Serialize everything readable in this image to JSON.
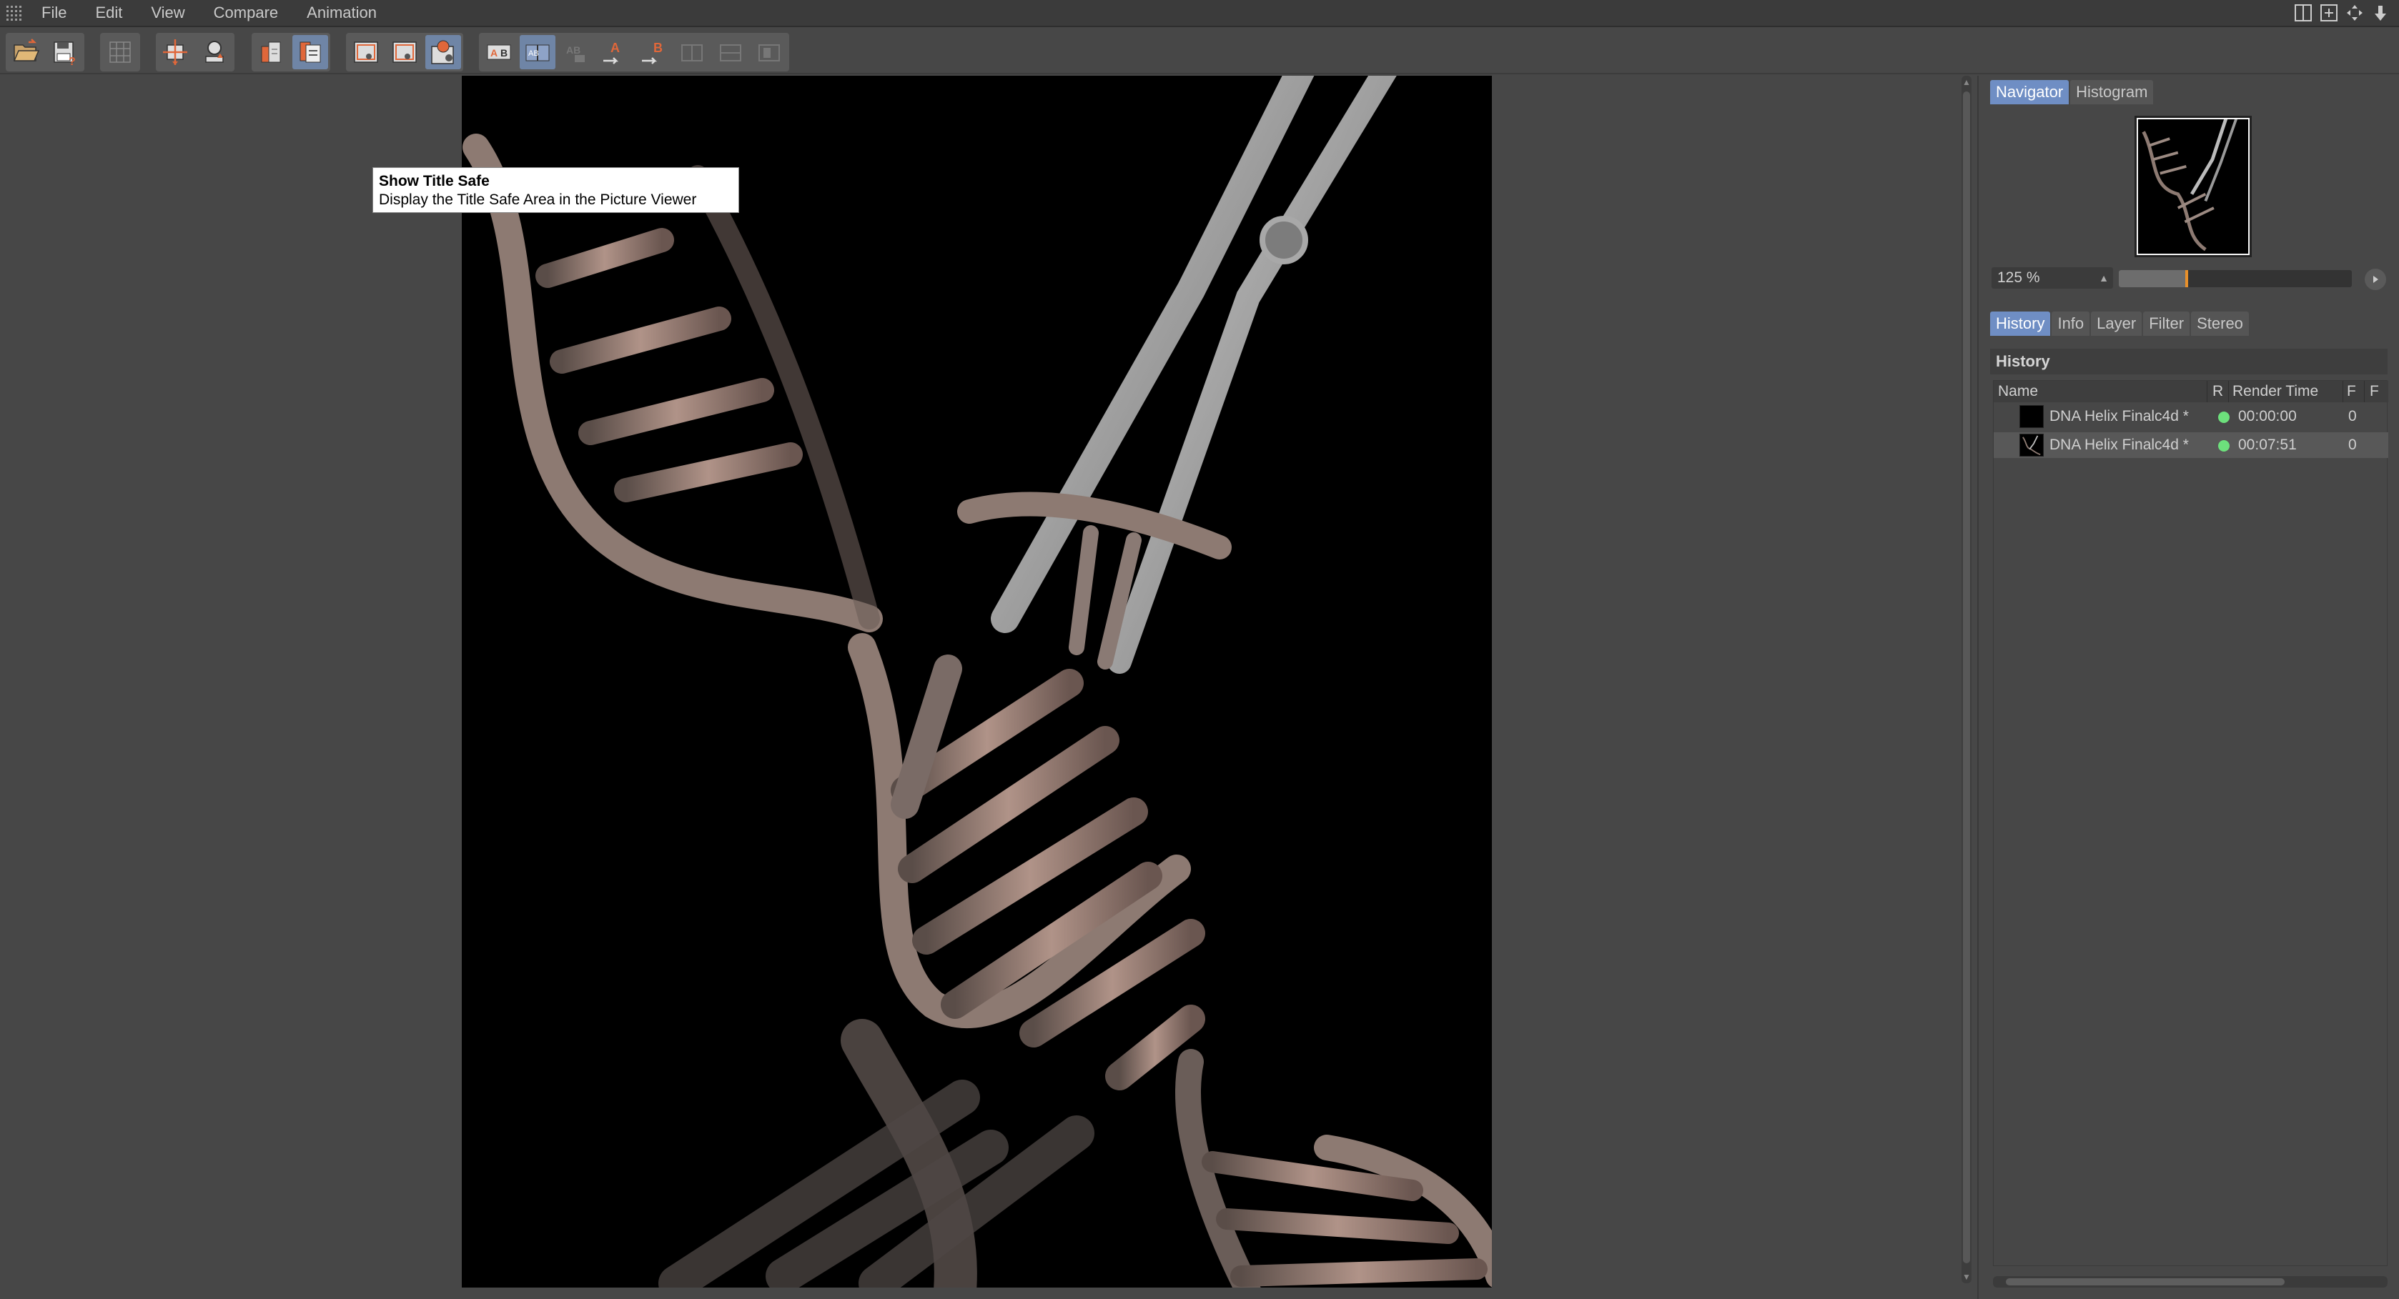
{
  "menubar": {
    "items": [
      "File",
      "Edit",
      "View",
      "Compare",
      "Animation"
    ]
  },
  "tooltip": {
    "title": "Show Title Safe",
    "description": "Display the Title Safe Area in the Picture Viewer"
  },
  "navigator": {
    "tabs": [
      "Navigator",
      "Histogram"
    ],
    "active_tab": "Navigator",
    "zoom_value": "125 %",
    "zoom_slider_fraction": 0.29
  },
  "lower_tabs": {
    "tabs": [
      "History",
      "Info",
      "Layer",
      "Filter",
      "Stereo"
    ],
    "active_tab": "History"
  },
  "history": {
    "title": "History",
    "columns": [
      "Name",
      "R",
      "Render Time",
      "F",
      "F"
    ],
    "rows": [
      {
        "name": "DNA Helix Finalc4d *",
        "status_color": "#6de07c",
        "render_time": "00:00:00",
        "frames": "0",
        "selected": false
      },
      {
        "name": "DNA Helix Finalc4d *",
        "status_color": "#6de07c",
        "render_time": "00:07:51",
        "frames": "0",
        "selected": true
      }
    ]
  },
  "colors": {
    "accent": "#6f8ec4",
    "toolbar_active": "#6f85a6",
    "icon_orange": "#e0673a",
    "slider_knob": "#e9902a"
  }
}
